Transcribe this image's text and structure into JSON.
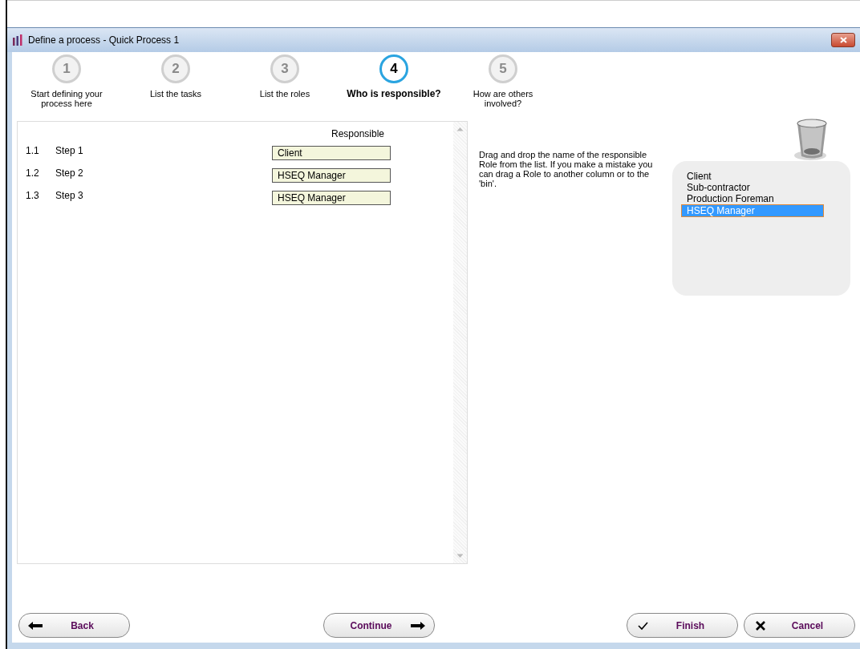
{
  "window": {
    "title": "Define a process - Quick Process 1"
  },
  "steps": [
    {
      "number": "1",
      "label": "Start defining your process here",
      "selected": false
    },
    {
      "number": "2",
      "label": "List the tasks",
      "selected": false
    },
    {
      "number": "3",
      "label": "List the roles",
      "selected": false
    },
    {
      "number": "4",
      "label": "Who is responsible?",
      "selected": true
    },
    {
      "number": "5",
      "label": "How are others involved?",
      "selected": false
    }
  ],
  "table": {
    "column_header": "Responsible",
    "rows": [
      {
        "number": "1.1",
        "task": "Step 1",
        "responsible": "Client"
      },
      {
        "number": "1.2",
        "task": "Step 2",
        "responsible": "HSEQ Manager"
      },
      {
        "number": "1.3",
        "task": "Step 3",
        "responsible": "HSEQ Manager"
      }
    ]
  },
  "instructions": "Drag and drop the name of the responsible Role from the list. If you make a mistake you can drag a Role to another column or to the 'bin'.",
  "roles": [
    {
      "name": "Client",
      "selected": false
    },
    {
      "name": "Sub-contractor",
      "selected": false
    },
    {
      "name": "Production Foreman",
      "selected": false
    },
    {
      "name": "HSEQ Manager",
      "selected": true
    }
  ],
  "buttons": [
    {
      "kind": "back",
      "label": "Back"
    },
    {
      "kind": "continue",
      "label": "Continue"
    },
    {
      "kind": "finish",
      "label": "Finish"
    },
    {
      "kind": "cancel",
      "label": "Cancel"
    }
  ]
}
